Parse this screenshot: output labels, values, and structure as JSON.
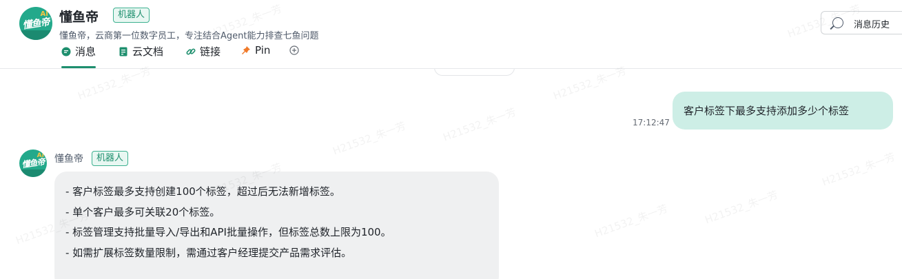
{
  "bot": {
    "name": "懂鱼帝",
    "badge": "机器人",
    "description": "懂鱼帝，云商第一位数字员工，专注结合Agent能力排查七鱼问题",
    "avatar_text": "懂鱼帝",
    "avatar_ai": "AI"
  },
  "header": {
    "history_button": "消息历史",
    "tabs": [
      {
        "label": "消息",
        "icon": "message-icon",
        "active": true
      },
      {
        "label": "云文档",
        "icon": "doc-icon",
        "active": false
      },
      {
        "label": "链接",
        "icon": "link-icon",
        "active": false
      },
      {
        "label": "Pin",
        "icon": "pin-icon",
        "active": false
      },
      {
        "label": "",
        "icon": "add-tab-icon",
        "active": false
      }
    ]
  },
  "chat": {
    "outgoing": {
      "text": "客户标签下最多支持添加多少个标签",
      "time": "17:12:47"
    },
    "incoming": {
      "sender": "懂鱼帝",
      "badge": "机器人",
      "lines": [
        "- 客户标签最多支持创建100个标签，超过后无法新增标签。",
        "- 单个客户最多可关联20个标签。",
        "- 标签管理支持批量导入/导出和API批量操作，但标签总数上限为100。",
        "- 如需扩展标签数量限制，需通过客户经理提交产品需求评估。"
      ]
    }
  },
  "watermark": "H21532_朱一芳",
  "colors": {
    "accent": "#1e8f6e",
    "my_bubble": "#cdeee6",
    "reply_bubble": "#eff0f1",
    "avatar": "#23a98b"
  }
}
